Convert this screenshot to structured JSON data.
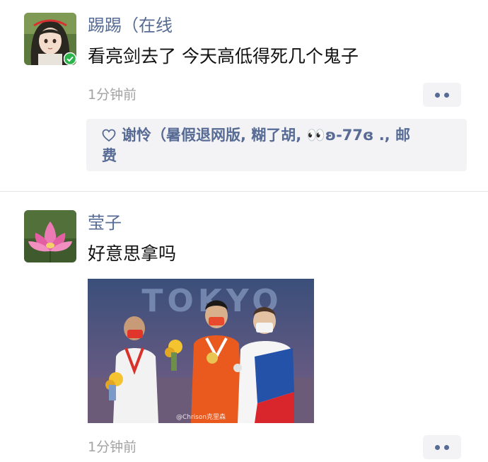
{
  "posts": [
    {
      "author": "踢踢（在线",
      "text": "看亮剑去了 今天高低得死几个鬼子",
      "time": "1分钟前",
      "likes_line1": "谢怜（暑假退网版, 糊了胡, 👀ʚ-77ɞ ., 邮",
      "likes_line2": "费"
    },
    {
      "author": "莹子",
      "text": "好意思拿吗",
      "time": "1分钟前",
      "image_text": "TOKYO",
      "image_watermark": "@Chrison克里森"
    }
  ],
  "icons": {
    "avatar1": "anime-girl-avatar",
    "avatar1_badge": "online-check-badge",
    "avatar2": "lotus-flower-avatar",
    "like": "heart-outline-icon",
    "more": "more-dots-icon"
  },
  "colors": {
    "author_link": "#576b95",
    "time": "#a3a3a3",
    "likes_bg": "#f3f3f5",
    "online_badge": "#2bb44a"
  }
}
